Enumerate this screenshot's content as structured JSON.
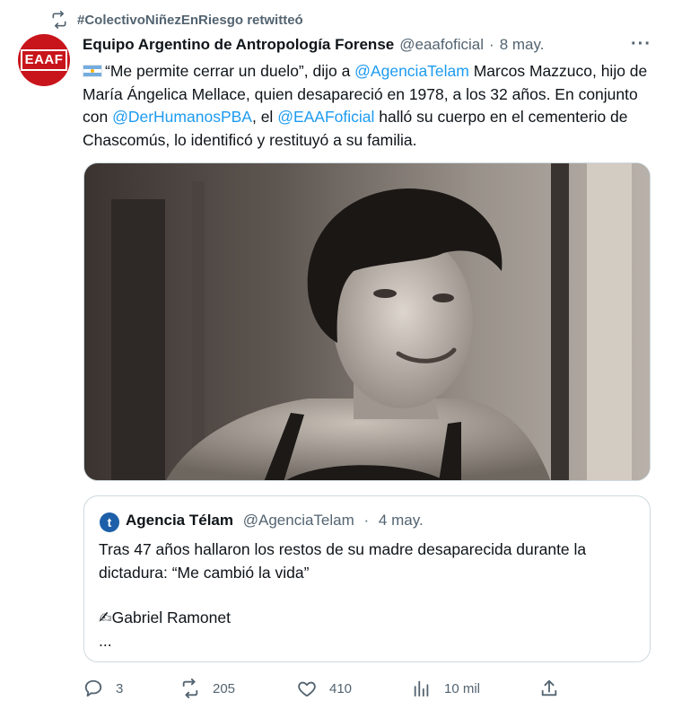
{
  "retweet": {
    "label": "#ColectivoNiñezEnRiesgo retwitteó"
  },
  "author": {
    "avatar_text": "EAAF",
    "name": "Equipo Argentino de Antropología Forense",
    "handle": "@eaafoficial",
    "separator": "·",
    "date": "8 may."
  },
  "more_label": "···",
  "tweet": {
    "t1": "“Me permite cerrar un duelo”, dijo a ",
    "m1": "@AgenciaTelam",
    "t2": " Marcos Mazzuco, hijo de María Ángelica Mellace, quien desapareció en 1978, a los 32 años. En conjunto con ",
    "m2": "@DerHumanosPBA",
    "t3": ", el ",
    "m3": "@EAAFoficial",
    "t4": " halló su cuerpo en el cementerio de Chascomús, lo identificó y restituyó a su familia."
  },
  "quote": {
    "avatar_text": "t",
    "name": "Agencia Télam",
    "handle": "@AgenciaTelam",
    "separator": "·",
    "date": "4 may.",
    "line1": "Tras 47 años hallaron los restos de su madre desaparecida durante la dictadura: “Me cambió la vida”",
    "line2": "✍Gabriel Ramonet",
    "line3": "..."
  },
  "actions": {
    "replies": "3",
    "retweets": "205",
    "likes": "410",
    "views": "10 mil"
  },
  "colors": {
    "accent": "#1d9bf0",
    "secondary_text": "#536471",
    "avatar_bg": "#c8151b"
  }
}
